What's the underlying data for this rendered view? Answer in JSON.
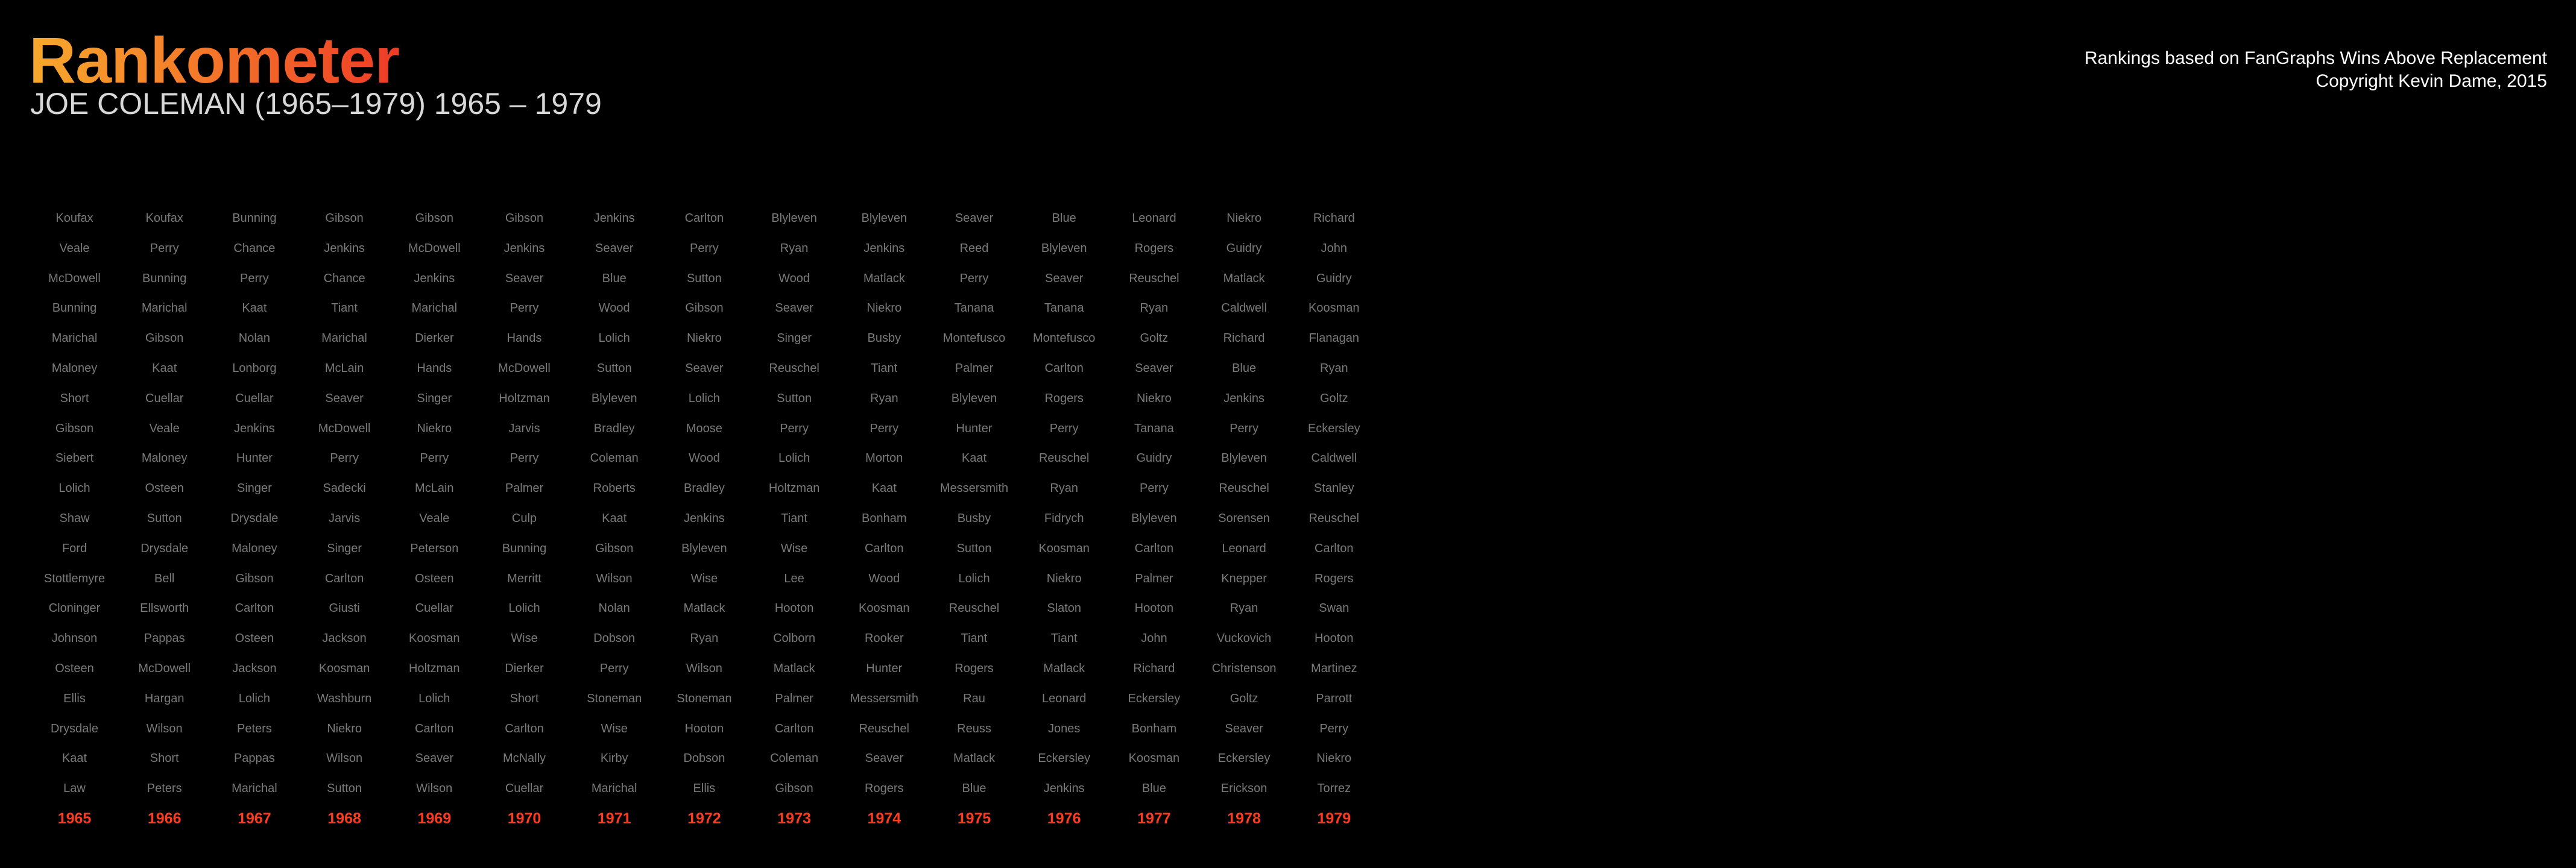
{
  "title": "Rankometer",
  "subtitle": "JOE COLEMAN (1965–1979) 1965 – 1979",
  "credits": {
    "line1": "Rankings based on FanGraphs Wins Above Replacement",
    "line2": "Copyright Kevin Dame, 2015"
  },
  "colors": {
    "background": "#000000",
    "names": "#7a7a7a",
    "years": "#ff3b1f",
    "title_gradient": [
      "#f7a92c",
      "#ee3b26"
    ]
  },
  "years": [
    "1965",
    "1966",
    "1967",
    "1968",
    "1969",
    "1970",
    "1971",
    "1972",
    "1973",
    "1974",
    "1975",
    "1976",
    "1977",
    "1978",
    "1979"
  ],
  "rows": [
    [
      "Koufax",
      "Koufax",
      "Bunning",
      "Gibson",
      "Gibson",
      "Gibson",
      "Jenkins",
      "Carlton",
      "Blyleven",
      "Blyleven",
      "Seaver",
      "Blue",
      "Leonard",
      "Niekro",
      "Richard"
    ],
    [
      "Veale",
      "Perry",
      "Chance",
      "Jenkins",
      "McDowell",
      "Jenkins",
      "Seaver",
      "Perry",
      "Ryan",
      "Jenkins",
      "Reed",
      "Blyleven",
      "Rogers",
      "Guidry",
      "John"
    ],
    [
      "McDowell",
      "Bunning",
      "Perry",
      "Chance",
      "Jenkins",
      "Seaver",
      "Blue",
      "Sutton",
      "Wood",
      "Matlack",
      "Perry",
      "Seaver",
      "Reuschel",
      "Matlack",
      "Guidry"
    ],
    [
      "Bunning",
      "Marichal",
      "Kaat",
      "Tiant",
      "Marichal",
      "Perry",
      "Wood",
      "Gibson",
      "Seaver",
      "Niekro",
      "Tanana",
      "Tanana",
      "Ryan",
      "Caldwell",
      "Koosman"
    ],
    [
      "Marichal",
      "Gibson",
      "Nolan",
      "Marichal",
      "Dierker",
      "Hands",
      "Lolich",
      "Niekro",
      "Singer",
      "Busby",
      "Montefusco",
      "Montefusco",
      "Goltz",
      "Richard",
      "Flanagan"
    ],
    [
      "Maloney",
      "Kaat",
      "Lonborg",
      "McLain",
      "Hands",
      "McDowell",
      "Sutton",
      "Seaver",
      "Reuschel",
      "Tiant",
      "Palmer",
      "Carlton",
      "Seaver",
      "Blue",
      "Ryan"
    ],
    [
      "Short",
      "Cuellar",
      "Cuellar",
      "Seaver",
      "Singer",
      "Holtzman",
      "Blyleven",
      "Lolich",
      "Sutton",
      "Ryan",
      "Blyleven",
      "Rogers",
      "Niekro",
      "Jenkins",
      "Goltz"
    ],
    [
      "Gibson",
      "Veale",
      "Jenkins",
      "McDowell",
      "Niekro",
      "Jarvis",
      "Bradley",
      "Moose",
      "Perry",
      "Perry",
      "Hunter",
      "Perry",
      "Tanana",
      "Perry",
      "Eckersley"
    ],
    [
      "Siebert",
      "Maloney",
      "Hunter",
      "Perry",
      "Perry",
      "Perry",
      "Coleman",
      "Wood",
      "Lolich",
      "Morton",
      "Kaat",
      "Reuschel",
      "Guidry",
      "Blyleven",
      "Caldwell"
    ],
    [
      "Lolich",
      "Osteen",
      "Singer",
      "Sadecki",
      "McLain",
      "Palmer",
      "Roberts",
      "Bradley",
      "Holtzman",
      "Kaat",
      "Messersmith",
      "Ryan",
      "Perry",
      "Reuschel",
      "Stanley"
    ],
    [
      "Shaw",
      "Sutton",
      "Drysdale",
      "Jarvis",
      "Veale",
      "Culp",
      "Kaat",
      "Jenkins",
      "Tiant",
      "Bonham",
      "Busby",
      "Fidrych",
      "Blyleven",
      "Sorensen",
      "Reuschel"
    ],
    [
      "Ford",
      "Drysdale",
      "Maloney",
      "Singer",
      "Peterson",
      "Bunning",
      "Gibson",
      "Blyleven",
      "Wise",
      "Carlton",
      "Sutton",
      "Koosman",
      "Carlton",
      "Leonard",
      "Carlton"
    ],
    [
      "Stottlemyre",
      "Bell",
      "Gibson",
      "Carlton",
      "Osteen",
      "Merritt",
      "Wilson",
      "Wise",
      "Lee",
      "Wood",
      "Lolich",
      "Niekro",
      "Palmer",
      "Knepper",
      "Rogers"
    ],
    [
      "Cloninger",
      "Ellsworth",
      "Carlton",
      "Giusti",
      "Cuellar",
      "Lolich",
      "Nolan",
      "Matlack",
      "Hooton",
      "Koosman",
      "Reuschel",
      "Slaton",
      "Hooton",
      "Ryan",
      "Swan"
    ],
    [
      "Johnson",
      "Pappas",
      "Osteen",
      "Jackson",
      "Koosman",
      "Wise",
      "Dobson",
      "Ryan",
      "Colborn",
      "Rooker",
      "Tiant",
      "Tiant",
      "John",
      "Vuckovich",
      "Hooton"
    ],
    [
      "Osteen",
      "McDowell",
      "Jackson",
      "Koosman",
      "Holtzman",
      "Dierker",
      "Perry",
      "Wilson",
      "Matlack",
      "Hunter",
      "Rogers",
      "Matlack",
      "Richard",
      "Christenson",
      "Martinez"
    ],
    [
      "Ellis",
      "Hargan",
      "Lolich",
      "Washburn",
      "Lolich",
      "Short",
      "Stoneman",
      "Stoneman",
      "Palmer",
      "Messersmith",
      "Rau",
      "Leonard",
      "Eckersley",
      "Goltz",
      "Parrott"
    ],
    [
      "Drysdale",
      "Wilson",
      "Peters",
      "Niekro",
      "Carlton",
      "Carlton",
      "Wise",
      "Hooton",
      "Carlton",
      "Reuschel",
      "Reuss",
      "Jones",
      "Bonham",
      "Seaver",
      "Perry"
    ],
    [
      "Kaat",
      "Short",
      "Pappas",
      "Wilson",
      "Seaver",
      "McNally",
      "Kirby",
      "Dobson",
      "Coleman",
      "Seaver",
      "Matlack",
      "Eckersley",
      "Koosman",
      "Eckersley",
      "Niekro"
    ],
    [
      "Law",
      "Peters",
      "Marichal",
      "Sutton",
      "Wilson",
      "Cuellar",
      "Marichal",
      "Ellis",
      "Gibson",
      "Rogers",
      "Blue",
      "Jenkins",
      "Blue",
      "Erickson",
      "Torrez"
    ]
  ]
}
